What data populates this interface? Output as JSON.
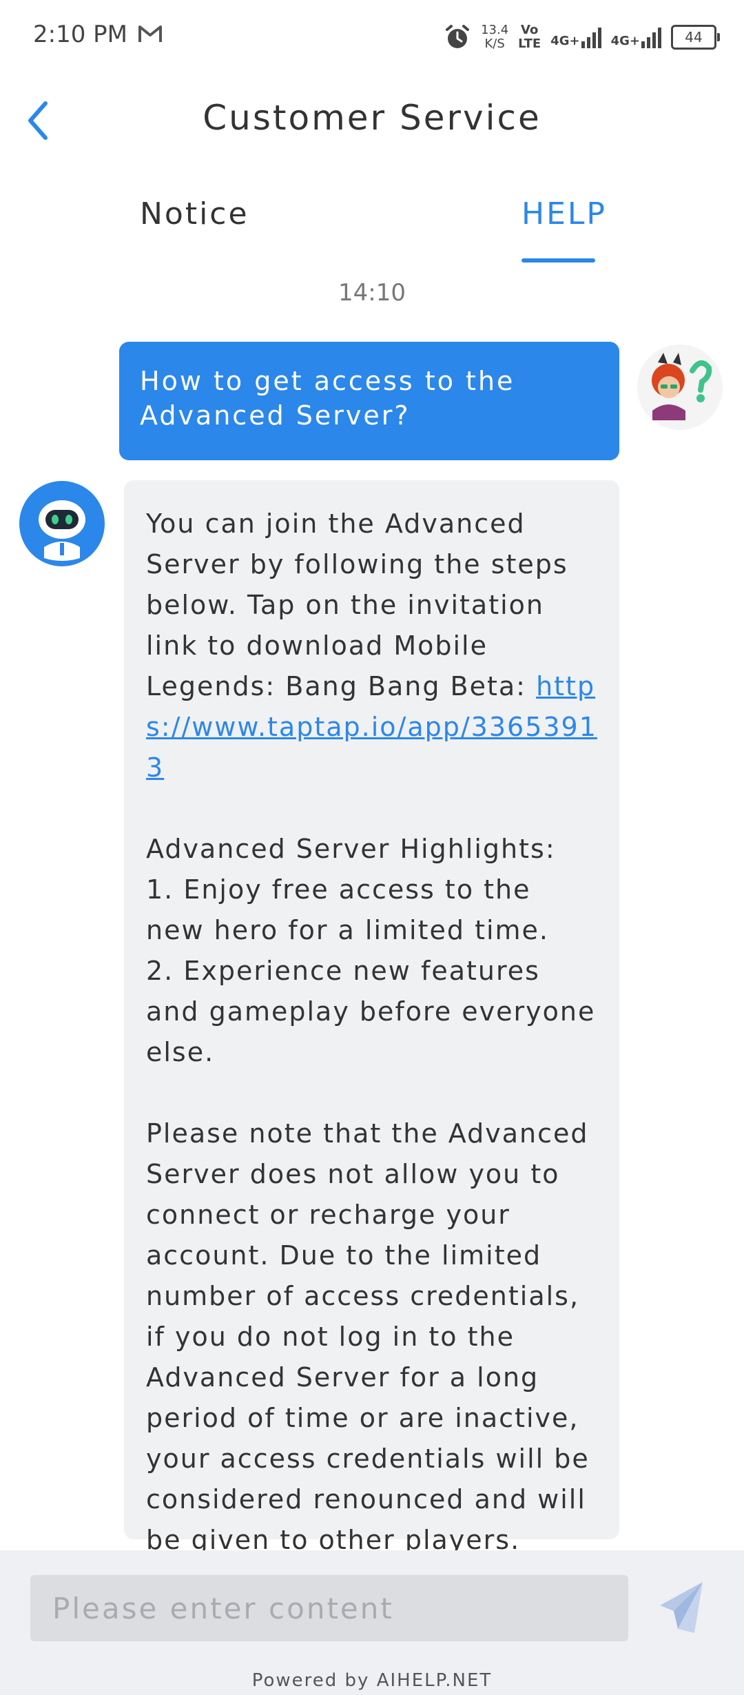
{
  "status_bar": {
    "time": "2:10 PM",
    "speed_value": "13.4",
    "speed_unit": "K/S",
    "volte_top": "Vo",
    "volte_bottom": "LTE",
    "signal1": "4G+",
    "signal2": "4G+",
    "battery": "44"
  },
  "header": {
    "title": "Customer Service"
  },
  "tabs": [
    {
      "label": "Notice",
      "active": false
    },
    {
      "label": "HELP",
      "active": true
    }
  ],
  "chat": {
    "timestamp": "14:10",
    "user_message": "How to get access to the Advanced Server?",
    "bot_message": {
      "intro": "You can join the Advanced Server by following the steps below. Tap on the invitation link to download Mobile Legends: Bang Bang Beta: ",
      "link": "https://www.taptap.io/app/33653913",
      "highlights_title": "Advanced Server Highlights:",
      "highlight_1": "1. Enjoy free access to the new hero for a limited time.",
      "highlight_2": "2. Experience new features and gameplay before everyone else.",
      "note": "Please note that the Advanced Server does not allow you to connect or recharge your account. Due to the limited number of access credentials, if you do not log in to the Advanced Server for a long period of time or are inactive, your access credentials will be considered renounced and will be given to other players. Thank you for your understanding!"
    }
  },
  "footer": {
    "input_placeholder": "Please enter content",
    "powered_by": "Powered by AIHELP.NET"
  },
  "colors": {
    "accent": "#2b87ea",
    "bot_bubble": "#f0f1f3",
    "footer_bg": "#eef0f3"
  }
}
